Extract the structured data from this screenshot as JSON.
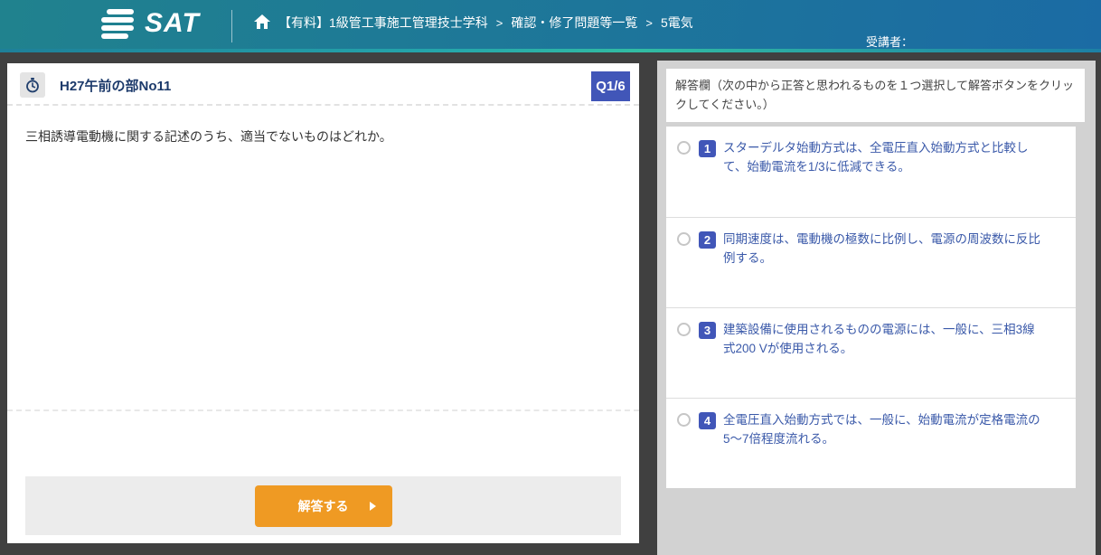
{
  "header": {
    "logo_text": "SAT",
    "breadcrumb": {
      "items": [
        "【有料】1級管工事施工管理技士学科",
        "確認・修了問題等一覧",
        "5電気"
      ],
      "separator": ">"
    },
    "student_label": "受講者："
  },
  "question": {
    "title": "H27午前の部No11",
    "badge": "Q1/6",
    "text": "三相誘導電動機に関する記述のうち、適当でないものはどれか。",
    "answer_button_label": "解答する"
  },
  "answer_panel": {
    "instruction": "解答欄（次の中から正答と思われるものを１つ選択して解答ボタンをクリックしてください。）",
    "options": [
      {
        "number": "1",
        "text": "スターデルタ始動方式は、全電圧直入始動方式と比較して、始動電流を1/3に低減できる。"
      },
      {
        "number": "2",
        "text": "同期速度は、電動機の極数に比例し、電源の周波数に反比例する。"
      },
      {
        "number": "3",
        "text": "建築設備に使用されるものの電源には、一般に、三相3線式200 Vが使用される。"
      },
      {
        "number": "4",
        "text": "全電圧直入始動方式では、一般に、始動電流が定格電流の5〜7倍程度流れる。"
      }
    ]
  },
  "colors": {
    "header_gradient_start": "#20828e",
    "header_gradient_end": "#1b6ba4",
    "page_background": "#404040",
    "badge_blue": "#4156b8",
    "option_text_blue": "#3a59a9",
    "title_navy": "#1c3a6b",
    "button_orange": "#ef9a23",
    "panel_gray": "#d2d2d2",
    "footer_gray": "#ececec"
  }
}
